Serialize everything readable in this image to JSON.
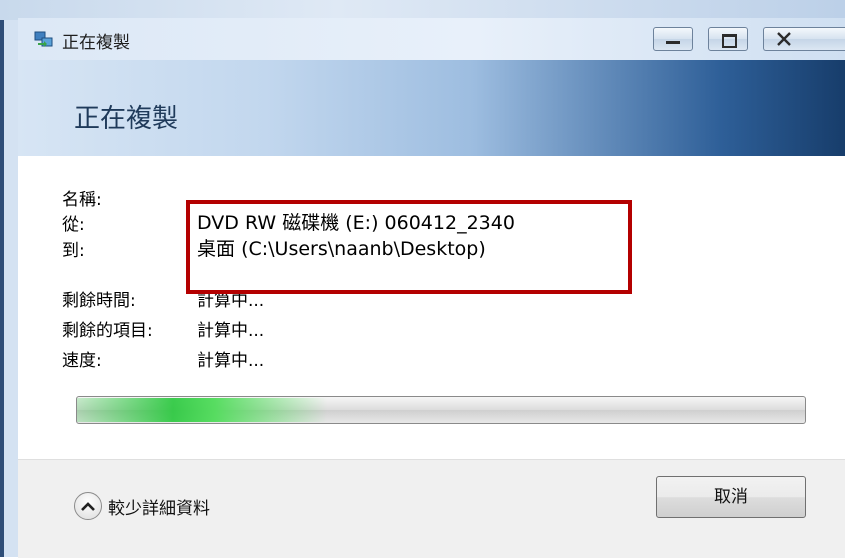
{
  "window": {
    "title": "正在複製",
    "header_title": "正在複製"
  },
  "details": {
    "name_label": "名稱:",
    "name_value": "",
    "from_label": "從:",
    "from_value": "DVD RW 磁碟機 (E:) 060412_2340",
    "to_label": "到:",
    "to_value_prefix": "桌面",
    "to_value_path": "(C:\\Users\\naanb\\Desktop)",
    "time_left_label": "剩餘時間:",
    "time_left_value": "計算中...",
    "items_left_label": "剩餘的項目:",
    "items_left_value": "計算中...",
    "speed_label": "速度:",
    "speed_value": "計算中..."
  },
  "progress": {
    "state": "indeterminate",
    "color": "#28c83c"
  },
  "footer": {
    "details_toggle_label": "較少詳細資料",
    "cancel_label": "取消"
  },
  "annotation": {
    "color": "#b40000"
  }
}
